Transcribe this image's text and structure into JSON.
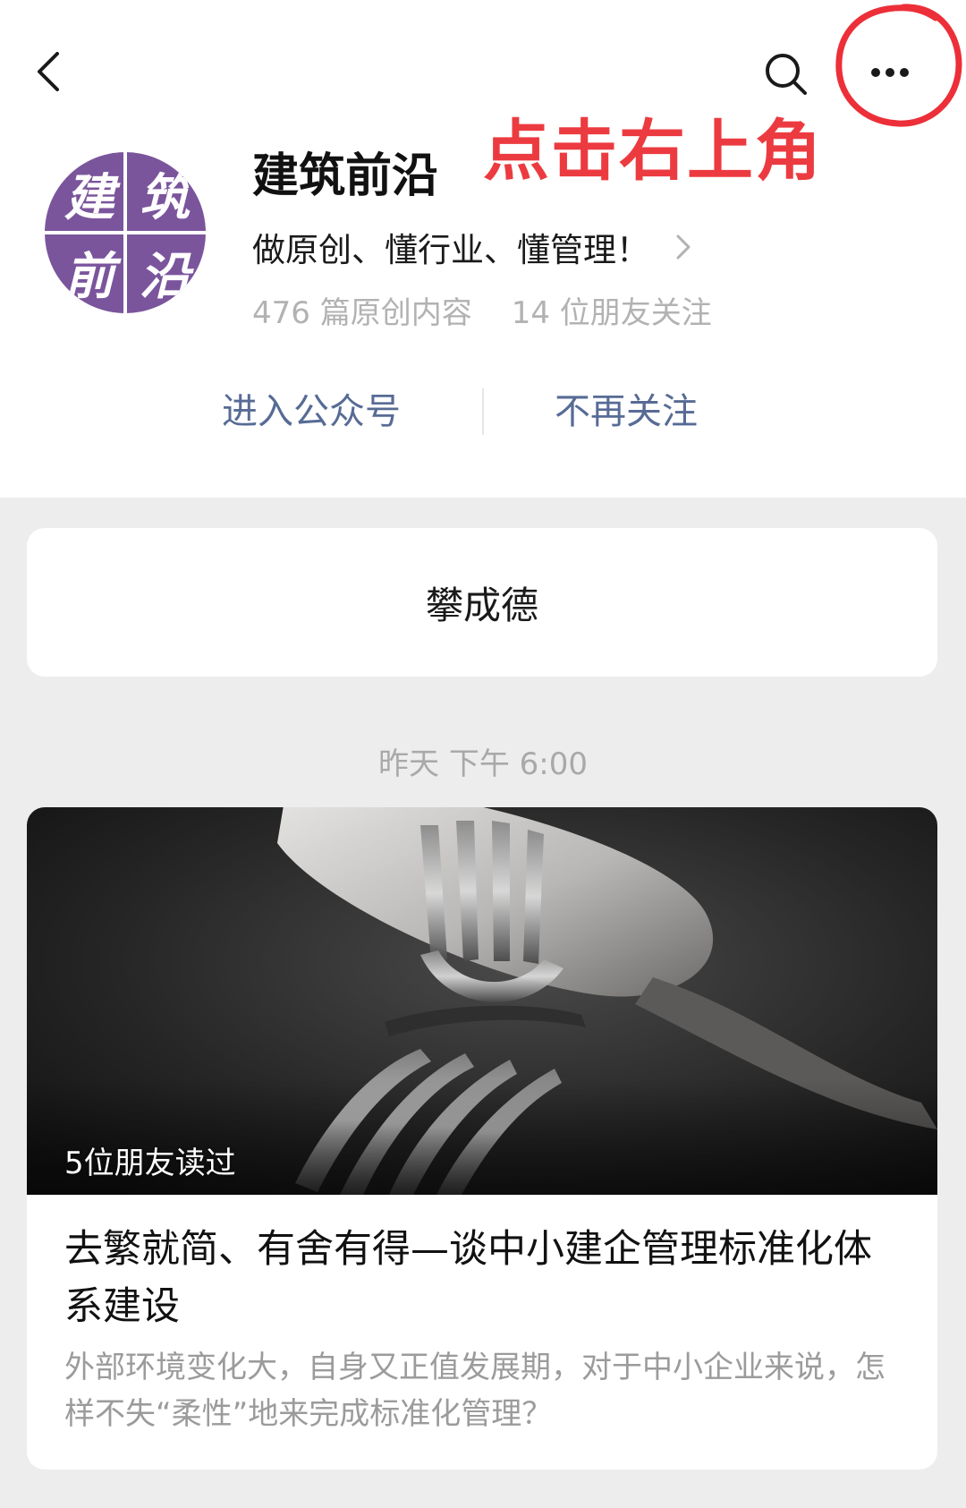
{
  "nav": {
    "back_icon": "chevron-left-icon",
    "search_icon": "search-icon",
    "more_icon": "more-dots-icon"
  },
  "annotation": {
    "text": "点击右上角",
    "color": "#ec3b40"
  },
  "account": {
    "avatar_chars": [
      "建",
      "筑",
      "前",
      "沿"
    ],
    "avatar_color": "#7a559c",
    "name": "建筑前沿",
    "slogan": "做原创、懂行业、懂管理！",
    "original_count": "476 篇原创内容",
    "friends_following": "14 位朋友关注"
  },
  "actions": {
    "enter": "进入公众号",
    "unfollow": "不再关注",
    "link_color": "#576b95"
  },
  "author_card": {
    "name": "攀成德"
  },
  "feed": {
    "timestamp": "昨天 下午 6:00"
  },
  "article": {
    "read_badge": "5位朋友读过",
    "title": "去繁就简、有舍有得—谈中小建企管理标准化体系建设",
    "summary": "外部环境变化大，自身又正值发展期，对于中小企业来说，怎样不失“柔性”地来完成标准化管理？"
  }
}
